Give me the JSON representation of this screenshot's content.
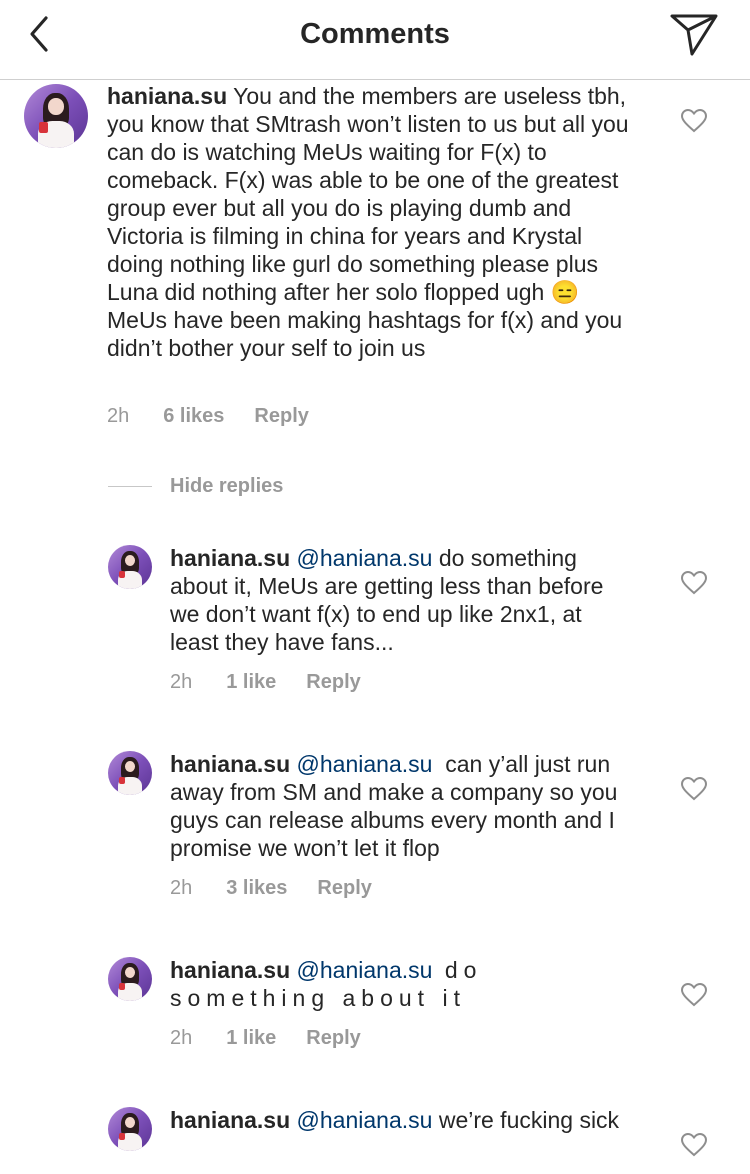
{
  "header": {
    "title": "Comments",
    "back_icon": "chevron-left-icon",
    "send_icon": "paper-plane-icon"
  },
  "comment": {
    "username": "haniana.su",
    "text": " You and the members are useless tbh, you know that SMtrash won’t listen to us but all you can do is watching MeUs waiting for F(x) to comeback. F(x) was able to be one of the greatest group ever but all you do is playing dumb and Victoria is filming in china for years and Krystal doing nothing like gurl do something please plus Luna did nothing after her solo flopped ugh 😑 MeUs have been making hashtags for f(x) and you didn’t bother your self to join us",
    "time": "2h",
    "likes": "6 likes",
    "reply": "Reply"
  },
  "hide_replies": "Hide replies",
  "replies": [
    {
      "username": "haniana.su",
      "mention": "@haniana.su",
      "text": " do something about it, MeUs are getting less than before we don’t want f(x) to end up like 2nx1, at least they have fans...",
      "time": "2h",
      "likes": "1 like",
      "reply": "Reply"
    },
    {
      "username": "haniana.su",
      "mention": "@haniana.su",
      "text": "  can y’all just run away from SM and make a company so you guys can release albums every month and I promise we won’t let it flop",
      "time": "2h",
      "likes": "3 likes",
      "reply": "Reply"
    },
    {
      "username": "haniana.su",
      "mention": "@haniana.su",
      "text": " do something about it",
      "time": "2h",
      "likes": "1 like",
      "reply": "Reply"
    },
    {
      "username": "haniana.su",
      "mention": "@haniana.su",
      "text": " we’re fucking sick"
    }
  ],
  "colors": {
    "text": "#262626",
    "meta": "#999999",
    "mention": "#00376b",
    "divider": "#cfcfcf"
  }
}
